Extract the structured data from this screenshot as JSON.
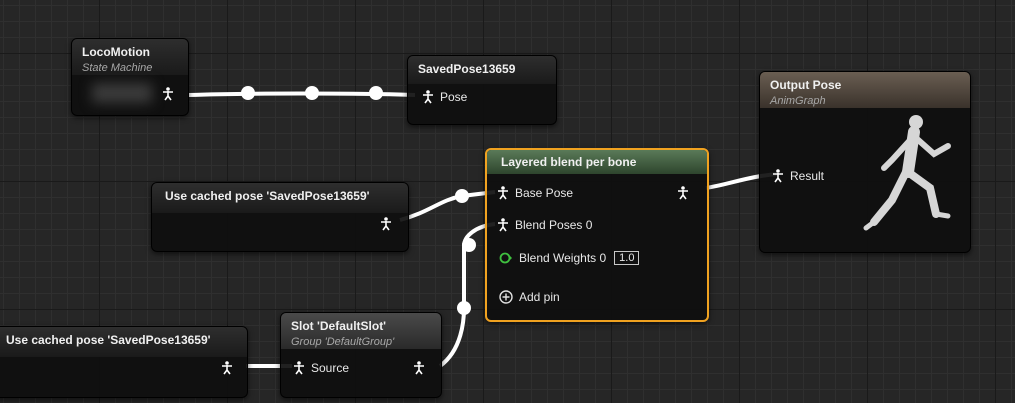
{
  "nodes": {
    "locomotion": {
      "title": "LocoMotion",
      "subtitle": "State Machine"
    },
    "saved_pose": {
      "title": "SavedPose13659",
      "pin_label": "Pose"
    },
    "output_pose": {
      "title": "Output Pose",
      "subtitle": "AnimGraph",
      "pin_label": "Result"
    },
    "cached_pose_a": {
      "title": "Use cached pose 'SavedPose13659'"
    },
    "cached_pose_b": {
      "title": "Use cached pose 'SavedPose13659'"
    },
    "layered_blend": {
      "title": "Layered blend per bone",
      "pins": {
        "base_pose": "Base Pose",
        "blend_poses": "Blend Poses 0",
        "blend_weights": "Blend Weights 0",
        "blend_weights_value": "1.0",
        "add_pin": "Add pin"
      }
    },
    "slot": {
      "title": "Slot 'DefaultSlot'",
      "subtitle": "Group 'DefaultGroup'",
      "pin_label": "Source"
    }
  },
  "colors": {
    "wire": "#ffffff",
    "selection": "#f0a220",
    "weight_pin": "#3fbf3f"
  },
  "icons": {
    "pose_pin": "pose-person-icon",
    "add": "plus-circle-icon",
    "preview": "running-mannequin-icon"
  }
}
